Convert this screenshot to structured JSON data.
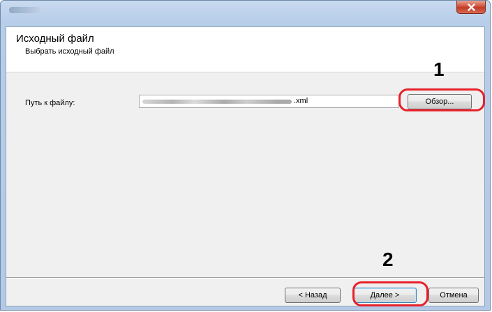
{
  "window": {
    "title": ""
  },
  "header": {
    "title": "Исходный файл",
    "subtitle": "Выбрать исходный файл"
  },
  "form": {
    "path_label": "Путь к файлу:",
    "path_value": ".xml",
    "browse_label": "Обзор..."
  },
  "footer": {
    "back_label": "< Назад",
    "next_label": "Далее >",
    "cancel_label": "Отмена"
  },
  "callouts": {
    "step1": "1",
    "step2": "2"
  },
  "colors": {
    "highlight": "#e8202a",
    "close_button": "#c13a26"
  },
  "icons": {
    "close": "close-icon"
  }
}
